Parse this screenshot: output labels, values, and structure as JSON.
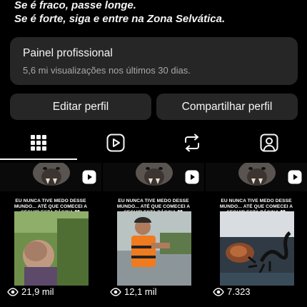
{
  "profile": {
    "bio_lines": [
      "Se é fraco, passe longe.",
      "Se é forte, siga e entre na Zona Selvática."
    ]
  },
  "dashboard": {
    "title": "Painel profissional",
    "subtitle": "5,6 mi visualizações nos últimos 30 dias."
  },
  "actions": {
    "edit_label": "Editar perfil",
    "share_label": "Compartilhar perfil"
  },
  "tabs": [
    {
      "icon": "grid-icon",
      "active": true
    },
    {
      "icon": "reels-icon",
      "active": false
    },
    {
      "icon": "reposts-icon",
      "active": false
    },
    {
      "icon": "tagged-icon",
      "active": false
    }
  ],
  "posts": [
    {
      "caption": "EU NUNCA TIVE MEDO DESSE MUNDO... ATÉ QUE COMECEI A SEGUIR ESTA PÁGINA 👀",
      "views": "21,9 mil",
      "icon": "reel-icon"
    },
    {
      "caption": "EU NUNCA TIVE MEDO DESSE MUNDO... ATÉ QUE COMECEI A SEGUIR ESTA PÁGINA 👀",
      "views": "12,1 mil",
      "icon": "reel-icon"
    },
    {
      "caption": "EU NUNCA TIVE MEDO DESSE MUNDO... ATÉ QUE COMECEI A SEGUIR ESTA PÁGINA 👀",
      "views": "7.323",
      "icon": "reel-icon"
    }
  ],
  "colors": {
    "background": "#000000",
    "card": "#262626",
    "text": "#f5f5f5",
    "muted": "#a8a8a8"
  }
}
